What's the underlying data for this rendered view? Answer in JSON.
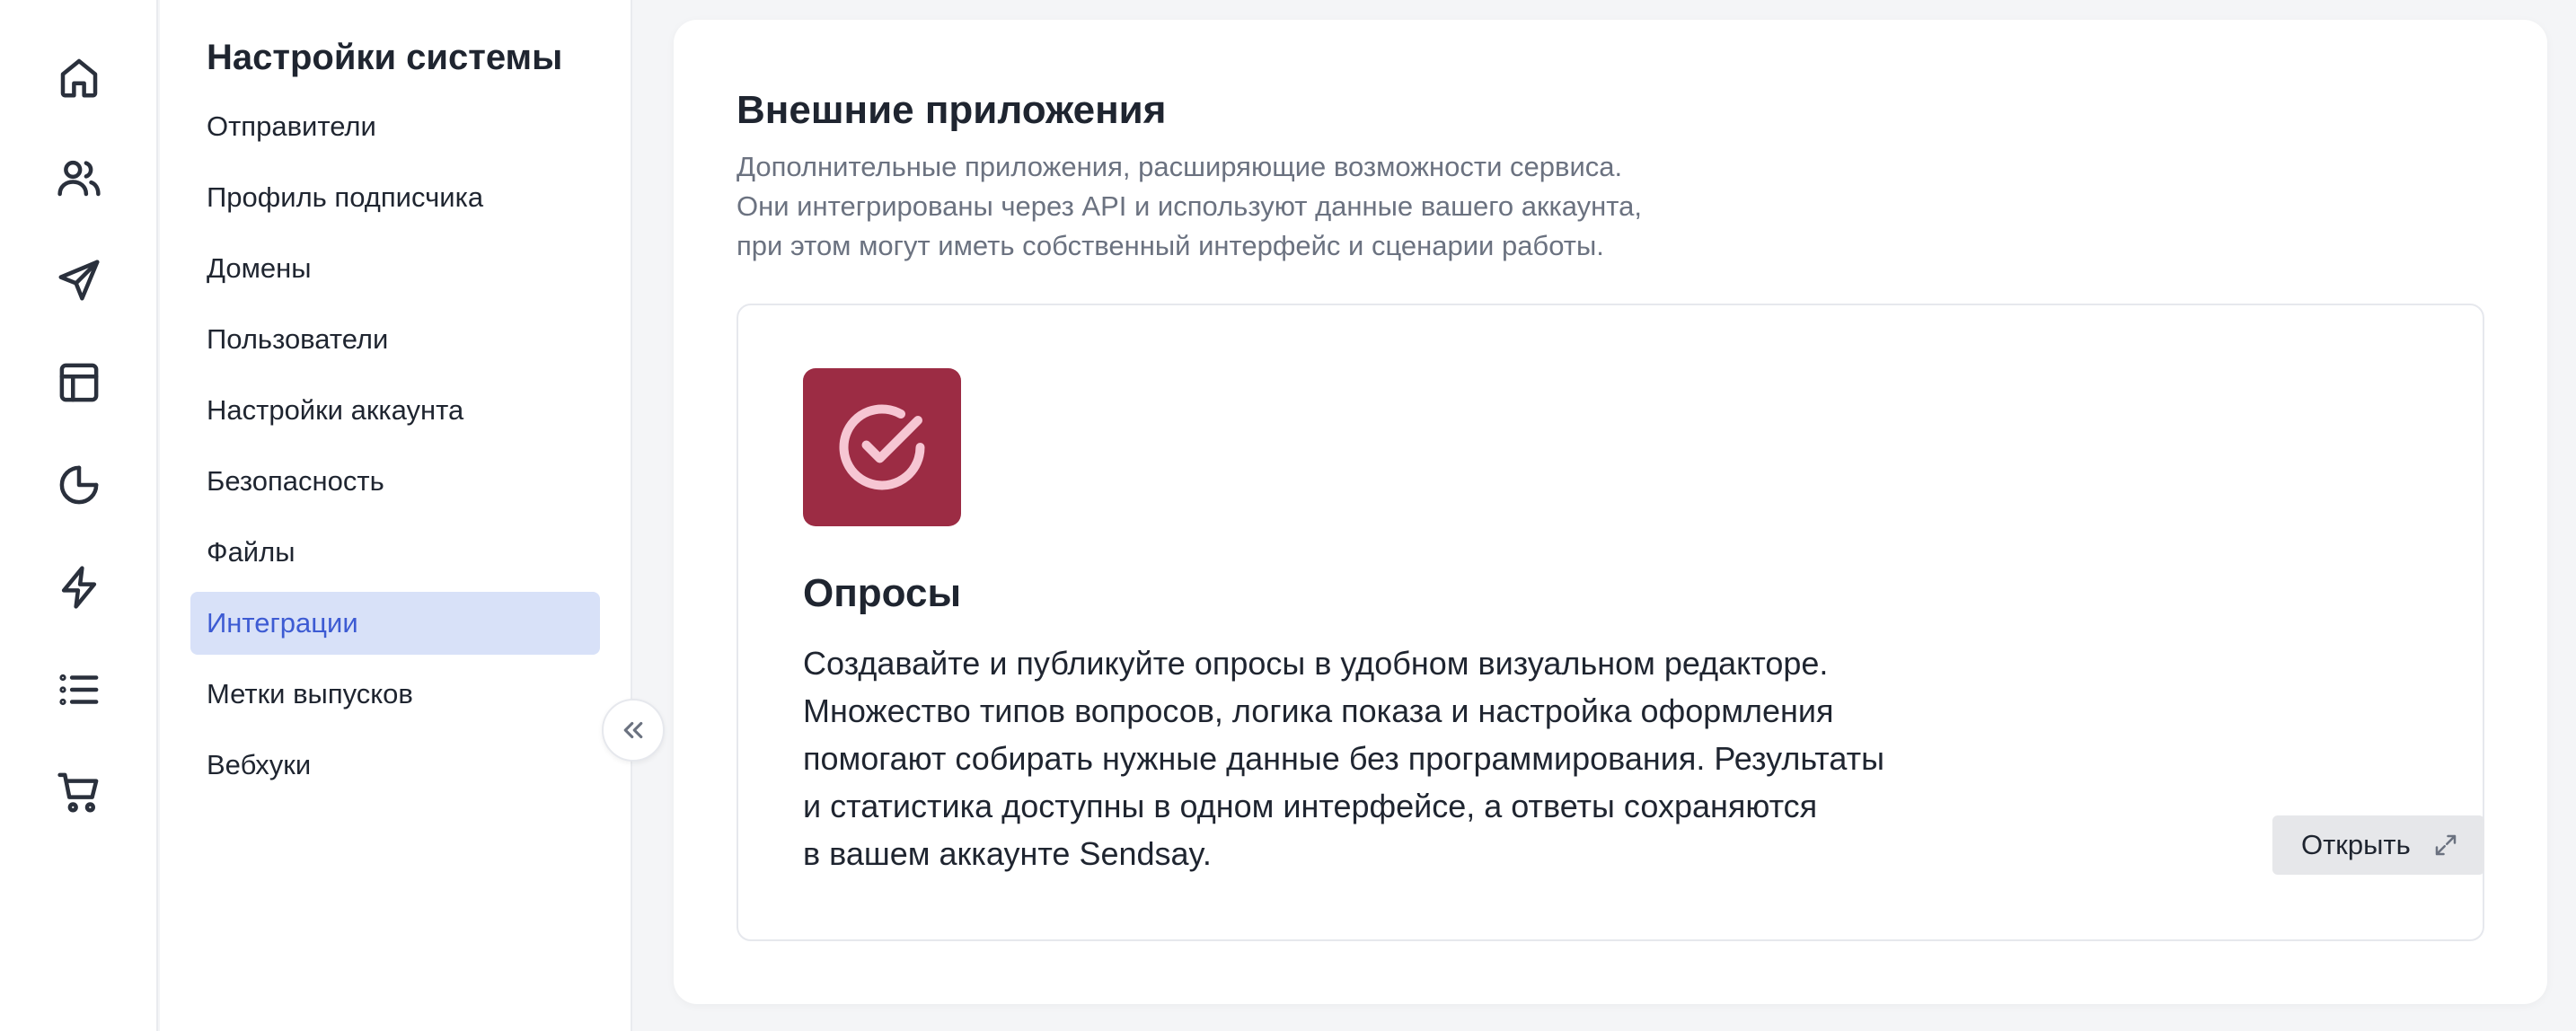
{
  "rail": {
    "icons": [
      "home-icon",
      "users-icon",
      "send-icon",
      "layout-icon",
      "pie-chart-icon",
      "lightning-icon",
      "list-icon",
      "cart-icon"
    ]
  },
  "sidebar": {
    "title": "Настройки системы",
    "items": [
      {
        "label": "Отправители",
        "active": false
      },
      {
        "label": "Профиль подписчика",
        "active": false
      },
      {
        "label": "Домены",
        "active": false
      },
      {
        "label": "Пользователи",
        "active": false
      },
      {
        "label": "Настройки аккаунта",
        "active": false
      },
      {
        "label": "Безопасность",
        "active": false
      },
      {
        "label": "Файлы",
        "active": false
      },
      {
        "label": "Интеграции",
        "active": true
      },
      {
        "label": "Метки выпусков",
        "active": false
      },
      {
        "label": "Вебхуки",
        "active": false
      }
    ],
    "collapse_icon": "chevrons-left-icon"
  },
  "main": {
    "title": "Внешние приложения",
    "description": [
      "Дополнительные приложения, расширяющие возможности сервиса.",
      "Они интегрированы через API и используют данные вашего аккаунта,",
      "при этом могут иметь собственный интерфейс и сценарии работы."
    ],
    "app": {
      "name": "Опросы",
      "logo_icon": "check-circle-icon",
      "logo_color": "#9c2c44",
      "description": [
        "Создавайте и публикуйте опросы в удобном визуальном редакторе.",
        "Множество типов вопросов, логика показа и настройка оформления",
        "помогают собирать нужные данные без программирования. Результаты",
        "и статистика доступны в одном интерфейсе, а ответы сохраняются",
        "в вашем аккаунте Sendsay."
      ],
      "open_label": "Открыть",
      "open_icon": "expand-icon"
    }
  },
  "colors": {
    "active_bg": "#d8e1f8",
    "active_text": "#3d5bd3",
    "muted_text": "#6b7280"
  }
}
